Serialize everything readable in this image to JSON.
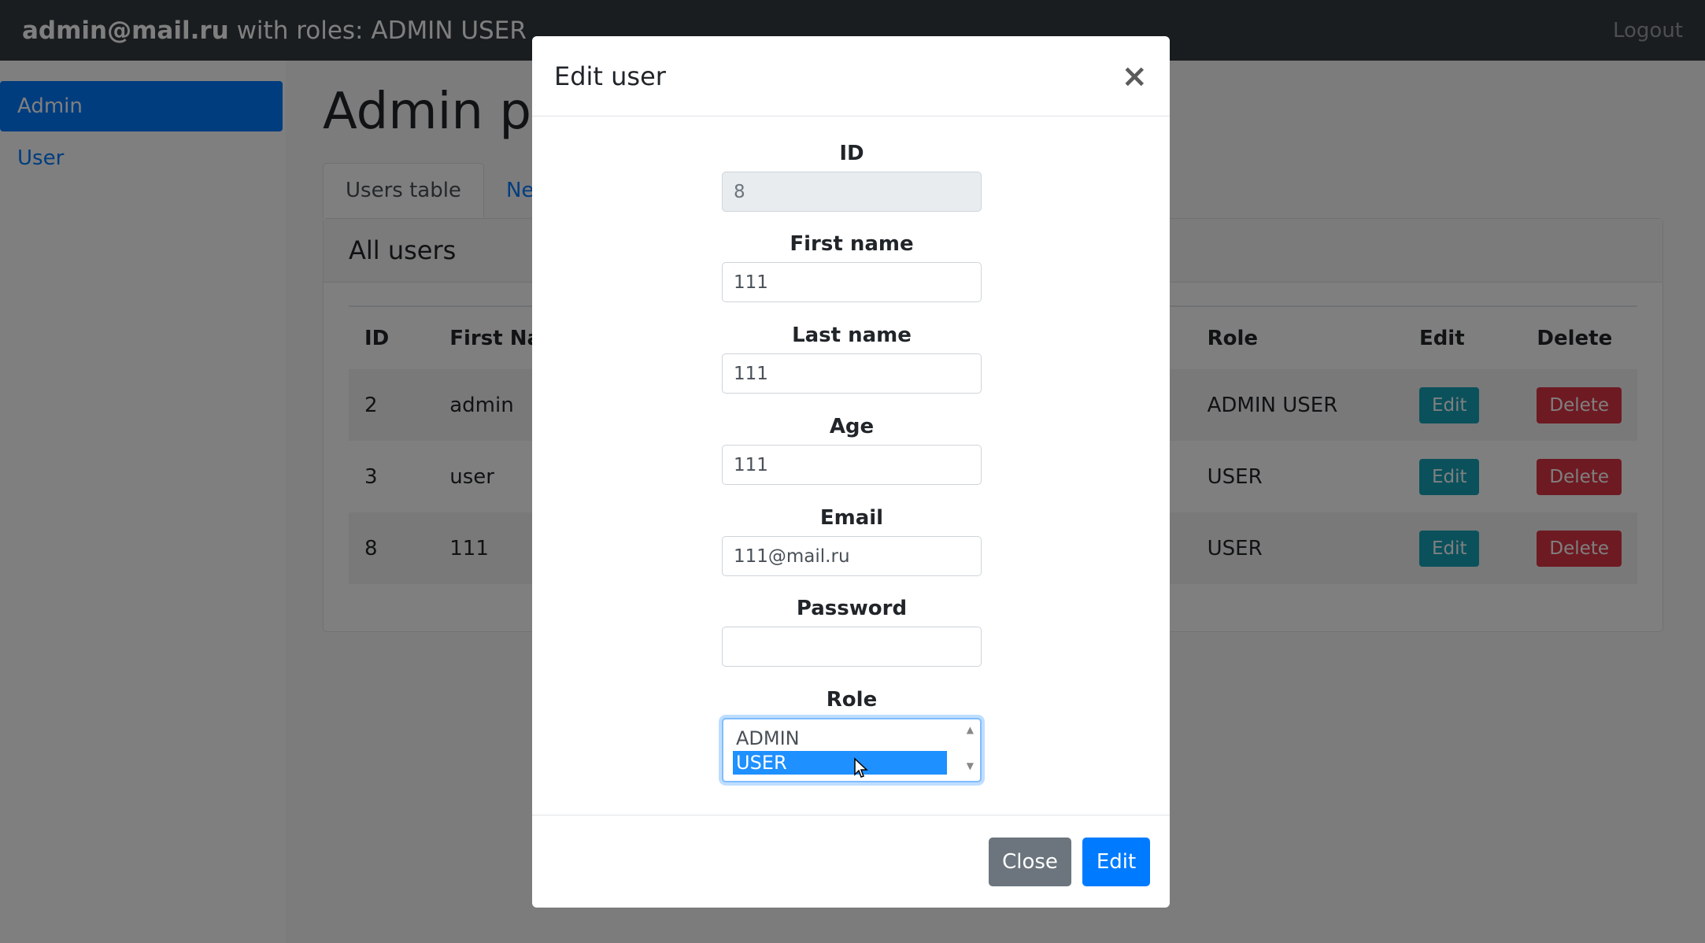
{
  "navbar": {
    "user_email": "admin@mail.ru",
    "roles_text": " with roles: ADMIN USER",
    "logout": "Logout"
  },
  "sidebar": {
    "items": [
      {
        "label": "Admin",
        "active": true
      },
      {
        "label": "User",
        "active": false
      }
    ]
  },
  "main": {
    "title": "Admin panel",
    "tabs": [
      {
        "label": "Users table"
      },
      {
        "label": "New User"
      }
    ],
    "card_title": "All users",
    "table": {
      "headers": [
        "ID",
        "First Name",
        "Role",
        "Edit",
        "Delete"
      ],
      "rows": [
        {
          "id": "2",
          "first_name": "admin",
          "role": "ADMIN USER"
        },
        {
          "id": "3",
          "first_name": "user",
          "role": "USER"
        },
        {
          "id": "8",
          "first_name": "111",
          "role": "USER"
        }
      ],
      "edit_label": "Edit",
      "delete_label": "Delete"
    }
  },
  "modal": {
    "title": "Edit user",
    "close_icon": "×",
    "fields": {
      "id": {
        "label": "ID",
        "value": "8"
      },
      "first_name": {
        "label": "First name",
        "value": "111"
      },
      "last_name": {
        "label": "Last name",
        "value": "111"
      },
      "age": {
        "label": "Age",
        "value": "111"
      },
      "email": {
        "label": "Email",
        "value": "111@mail.ru"
      },
      "password": {
        "label": "Password",
        "value": ""
      },
      "role": {
        "label": "Role",
        "options": [
          "ADMIN",
          "USER"
        ],
        "selected": "USER"
      }
    },
    "buttons": {
      "close": "Close",
      "edit": "Edit"
    }
  },
  "colors": {
    "navbar_bg": "#343a40",
    "primary": "#007bff",
    "info": "#17a2b8",
    "danger": "#dc3545",
    "secondary": "#6c757d"
  }
}
